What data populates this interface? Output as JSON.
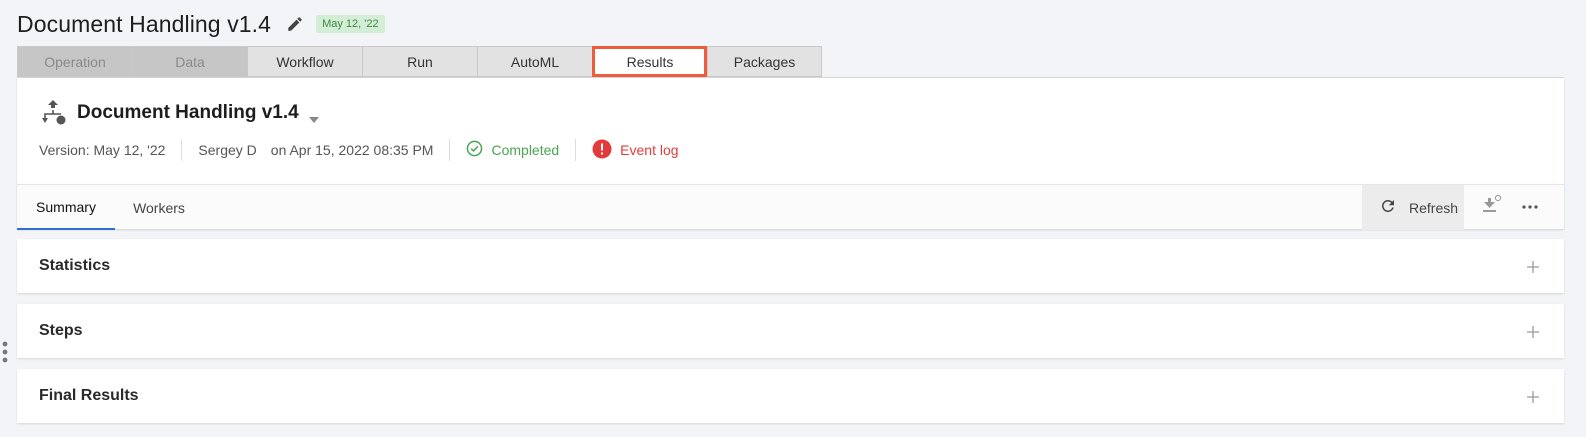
{
  "header": {
    "title": "Document Handling v1.4",
    "edit_icon": "pencil-icon",
    "version_badge": "May 12, '22"
  },
  "main_tabs": [
    {
      "label": "Operation",
      "state": "disabled"
    },
    {
      "label": "Data",
      "state": "disabled"
    },
    {
      "label": "Workflow",
      "state": "normal"
    },
    {
      "label": "Run",
      "state": "normal"
    },
    {
      "label": "AutoML",
      "state": "normal"
    },
    {
      "label": "Results",
      "state": "active"
    },
    {
      "label": "Packages",
      "state": "normal"
    }
  ],
  "info": {
    "icon": "pipeline-icon",
    "title": "Document Handling v1.4",
    "version": "Version: May 12, '22",
    "author": "Sergey D",
    "date": "on Apr 15, 2022 08:35 PM",
    "status": "Completed",
    "event_log": "Event log"
  },
  "sub_tabs": [
    {
      "label": "Summary",
      "active": true
    },
    {
      "label": "Workers",
      "active": false
    }
  ],
  "toolbar": {
    "refresh_label": "Refresh",
    "download_icon": "download-icon",
    "more_icon": "more-icon"
  },
  "sections": [
    {
      "title": "Statistics"
    },
    {
      "title": "Steps"
    },
    {
      "title": "Final Results"
    }
  ],
  "colors": {
    "accent_blue": "#2e6fd0",
    "active_tab_outline": "#ee5b3d",
    "success": "#4aa552",
    "error": "#e33b3b",
    "badge_bg": "#d4edd6"
  }
}
